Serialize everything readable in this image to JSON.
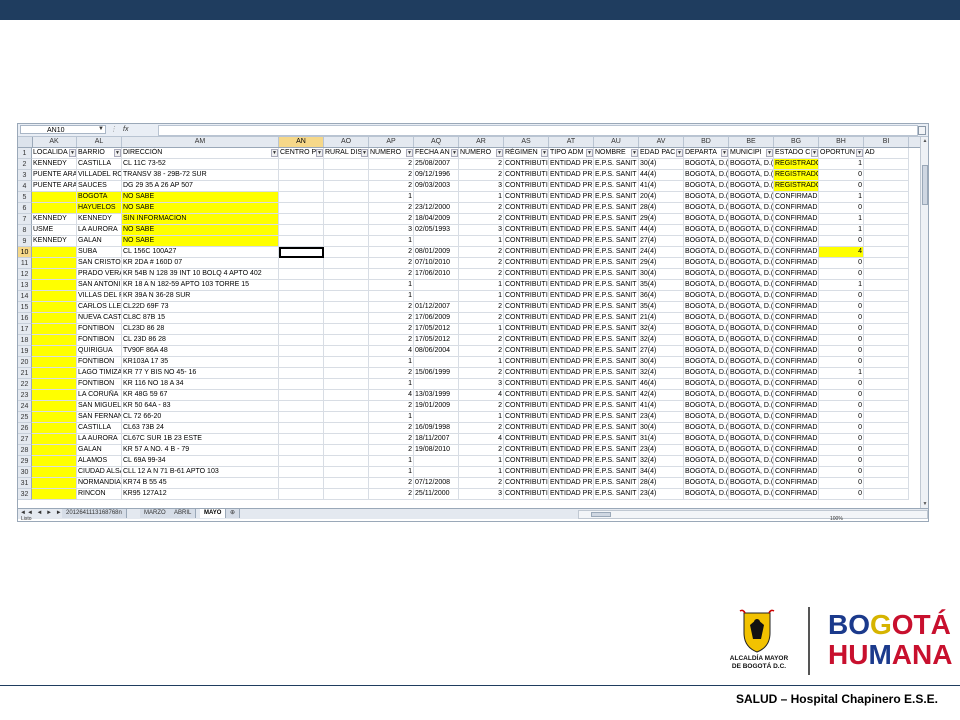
{
  "formula_bar": {
    "name_box": "AN10",
    "fx_label": "fx"
  },
  "columns": [
    {
      "letter": "AK",
      "header": "LOCALIDA",
      "width": 45
    },
    {
      "letter": "AL",
      "header": "BARRIO",
      "width": 45
    },
    {
      "letter": "AM",
      "header": "DIRECCIÓN",
      "width": 157
    },
    {
      "letter": "AN",
      "header": "CENTRO P",
      "width": 45,
      "selected": true
    },
    {
      "letter": "AO",
      "header": "RURAL DIS",
      "width": 45
    },
    {
      "letter": "AP",
      "header": "NÚMERO",
      "width": 45
    },
    {
      "letter": "AQ",
      "header": "FECHA AN",
      "width": 45
    },
    {
      "letter": "AR",
      "header": "NÚMERO",
      "width": 45
    },
    {
      "letter": "AS",
      "header": "RÉGIMEN",
      "width": 45
    },
    {
      "letter": "AT",
      "header": "TIPO ADM",
      "width": 45
    },
    {
      "letter": "AU",
      "header": "NOMBRE",
      "width": 45
    },
    {
      "letter": "AV",
      "header": "EDAD PAC",
      "width": 45
    },
    {
      "letter": "BD",
      "header": "DEPARTA",
      "width": 45
    },
    {
      "letter": "BE",
      "header": "MUNICIPI",
      "width": 45
    },
    {
      "letter": "BG",
      "header": "ESTADO C",
      "width": 45
    },
    {
      "letter": "BH",
      "header": "OPORTUN",
      "width": 45
    },
    {
      "letter": "BI",
      "header": "AD",
      "width": 45
    }
  ],
  "rows": [
    {
      "n": "2",
      "c": [
        "KENNEDY",
        "CASTILLA",
        "CL 11C 73-52",
        "",
        "",
        "2",
        "25/08/2007",
        "2",
        "CONTRIBUTI",
        "ENTIDAD PR",
        "E.P.S. SANIT",
        "30(4)",
        "BOGOTÁ, D.(",
        "BOGOTÁ, D.(",
        "REGISTRADO",
        "1",
        ""
      ],
      "y": [
        14
      ]
    },
    {
      "n": "3",
      "c": [
        "PUENTE ARA",
        "VILLADEL RO",
        "TRANSV 38 - 29B-72 SUR",
        "",
        "",
        "2",
        "09/12/1996",
        "2",
        "CONTRIBUTI",
        "ENTIDAD PR",
        "E.P.S. SANIT",
        "44(4)",
        "BOGOTÁ, D.(",
        "BOGOTÁ, D.(",
        "REGISTRADO",
        "0",
        ""
      ],
      "y": [
        14
      ]
    },
    {
      "n": "4",
      "c": [
        "PUENTE ARA",
        "SAUCES",
        "DG 29 35 A 26 AP 507",
        "",
        "",
        "2",
        "09/03/2003",
        "3",
        "CONTRIBUTI",
        "ENTIDAD PR",
        "E.P.S. SANIT",
        "41(4)",
        "BOGOTÁ, D.(",
        "BOGOTÁ, D.(",
        "REGISTRADO",
        "0",
        ""
      ],
      "y": [
        14
      ]
    },
    {
      "n": "5",
      "c": [
        "",
        "BOGOTA",
        "NO SABE",
        "",
        "",
        "1",
        "",
        "1",
        "CONTRIBUTI",
        "ENTIDAD PR",
        "E.P.S. SANIT",
        "20(4)",
        "BOGOTÁ, D.(",
        "BOGOTÁ, D.(",
        "CONFIRMAD",
        "1",
        ""
      ],
      "y": [
        0,
        1,
        2
      ]
    },
    {
      "n": "6",
      "c": [
        "",
        "HAYUELOS",
        "NO SABE",
        "",
        "",
        "2",
        "23/12/2000",
        "2",
        "CONTRIBUTI",
        "ENTIDAD PR",
        "E.P.S. SANIT",
        "28(4)",
        "BOGOTÁ, D.(",
        "BOGOTÁ, D.(",
        "CONFIRMAD",
        "0",
        ""
      ],
      "y": [
        0,
        1,
        2
      ]
    },
    {
      "n": "7",
      "c": [
        "KENNEDY",
        "KENNEDY",
        "SIN INFORMACION",
        "",
        "",
        "2",
        "18/04/2009",
        "2",
        "CONTRIBUTI",
        "ENTIDAD PR",
        "E.P.S. SANIT",
        "29(4)",
        "BOGOTÁ, D.(",
        "BOGOTÁ, D.(",
        "CONFIRMAD",
        "1",
        ""
      ],
      "y": [
        2
      ]
    },
    {
      "n": "8",
      "c": [
        "USME",
        "LA AURORA",
        "NO SABE",
        "",
        "",
        "3",
        "02/05/1993",
        "3",
        "CONTRIBUTI",
        "ENTIDAD PR",
        "E.P.S. SANIT",
        "44(4)",
        "BOGOTÁ, D.(",
        "BOGOTÁ, D.(",
        "CONFIRMAD",
        "1",
        ""
      ],
      "y": [
        2
      ]
    },
    {
      "n": "9",
      "c": [
        "KENNEDY",
        "GALAN",
        "NO SABE",
        "",
        "",
        "1",
        "",
        "1",
        "CONTRIBUTI",
        "ENTIDAD PR",
        "E.P.S. SANIT",
        "27(4)",
        "BOGOTÁ, D.(",
        "BOGOTÁ, D.(",
        "CONFIRMAD",
        "0",
        ""
      ],
      "y": [
        2
      ]
    },
    {
      "n": "10",
      "c": [
        "",
        "SUBA",
        "CL 156C 100A27",
        "",
        "",
        "2",
        "08/01/2009",
        "2",
        "CONTRIBUTI",
        "ENTIDAD PR",
        "E.P.S. SANIT",
        "24(4)",
        "BOGOTÁ, D.(",
        "BOGOTÁ, D.(",
        "CONFIRMAD",
        "4",
        ""
      ],
      "y": [
        0,
        15
      ],
      "active": true
    },
    {
      "n": "11",
      "c": [
        "",
        "SAN CRISTOB",
        "KR 2DA # 160D 07",
        "",
        "",
        "2",
        "07/10/2010",
        "2",
        "CONTRIBUTI",
        "ENTIDAD PR",
        "E.P.S. SANIT",
        "29(4)",
        "BOGOTÁ, D.(",
        "BOGOTÁ, D.(",
        "CONFIRMAD",
        "0",
        ""
      ],
      "y": [
        0
      ]
    },
    {
      "n": "12",
      "c": [
        "",
        "PRADO VERA",
        "KR 54B N 128 39 INT 10 BOLQ 4 APTO 402",
        "",
        "",
        "2",
        "17/06/2010",
        "2",
        "CONTRIBUTI",
        "ENTIDAD PR",
        "E.P.S. SANIT",
        "30(4)",
        "BOGOTÁ, D.(",
        "BOGOTÁ, D.(",
        "CONFIRMAD",
        "0",
        ""
      ],
      "y": [
        0
      ]
    },
    {
      "n": "13",
      "c": [
        "",
        "SAN ANTONI",
        "KR 18 A N 182-59 APTO 103 TORRE 15",
        "",
        "",
        "1",
        "",
        "1",
        "CONTRIBUTI",
        "ENTIDAD PR",
        "E.P.S. SANIT",
        "35(4)",
        "BOGOTÁ, D.(",
        "BOGOTÁ, D.(",
        "CONFIRMAD",
        "1",
        ""
      ],
      "y": [
        0
      ]
    },
    {
      "n": "14",
      "c": [
        "",
        "VILLAS DEL R",
        "KR 39A N 36-28 SUR",
        "",
        "",
        "1",
        "",
        "1",
        "CONTRIBUTI",
        "ENTIDAD PR",
        "E.P.S. SANIT",
        "36(4)",
        "BOGOTÁ, D.(",
        "BOGOTÁ, D.(",
        "CONFIRMAD",
        "0",
        ""
      ],
      "y": [
        0
      ]
    },
    {
      "n": "15",
      "c": [
        "",
        "CARLOS LLER",
        "CL22D 69F 73",
        "",
        "",
        "2",
        "01/12/2007",
        "2",
        "CONTRIBUTI",
        "ENTIDAD PR",
        "E.P.S. SANIT",
        "35(4)",
        "BOGOTÁ, D.(",
        "BOGOTÁ, D.(",
        "CONFIRMAD",
        "0",
        ""
      ],
      "y": [
        0
      ]
    },
    {
      "n": "16",
      "c": [
        "",
        "NUEVA CAST",
        "CL8C 87B 15",
        "",
        "",
        "2",
        "17/06/2009",
        "2",
        "CONTRIBUTI",
        "ENTIDAD PR",
        "E.P.S. SANIT",
        "21(4)",
        "BOGOTÁ, D.(",
        "BOGOTÁ, D.(",
        "CONFIRMAD",
        "0",
        ""
      ],
      "y": [
        0
      ]
    },
    {
      "n": "17",
      "c": [
        "",
        "FONTIBON",
        "CL23D 86 28",
        "",
        "",
        "2",
        "17/05/2012",
        "1",
        "CONTRIBUTI",
        "ENTIDAD PR",
        "E.P.S. SANIT",
        "32(4)",
        "BOGOTÁ, D.(",
        "BOGOTÁ, D.(",
        "CONFIRMAD",
        "0",
        ""
      ],
      "y": [
        0
      ]
    },
    {
      "n": "18",
      "c": [
        "",
        "FONTIBON",
        "CL 23D 86 28",
        "",
        "",
        "2",
        "17/05/2012",
        "2",
        "CONTRIBUTI",
        "ENTIDAD PR",
        "E.P.S. SANIT",
        "32(4)",
        "BOGOTÁ, D.(",
        "BOGOTÁ, D.(",
        "CONFIRMAD",
        "0",
        ""
      ],
      "y": [
        0
      ]
    },
    {
      "n": "19",
      "c": [
        "",
        "QUIRIGUA",
        "TV90F 86A 48",
        "",
        "",
        "4",
        "08/06/2004",
        "2",
        "CONTRIBUTI",
        "ENTIDAD PR",
        "E.P.S. SANIT",
        "27(4)",
        "BOGOTÁ, D.(",
        "BOGOTÁ, D.(",
        "CONFIRMAD",
        "0",
        ""
      ],
      "y": [
        0
      ]
    },
    {
      "n": "20",
      "c": [
        "",
        "FONTIBON",
        "KR103A 17 35",
        "",
        "",
        "1",
        "",
        "1",
        "CONTRIBUTI",
        "ENTIDAD PR",
        "E.P.S. SANIT",
        "30(4)",
        "BOGOTÁ, D.(",
        "BOGOTÁ, D.(",
        "CONFIRMAD",
        "0",
        ""
      ],
      "y": [
        0
      ]
    },
    {
      "n": "21",
      "c": [
        "",
        "LAGO TIMIZA",
        "KR 77 Y BIS NO 45- 16",
        "",
        "",
        "2",
        "15/06/1999",
        "2",
        "CONTRIBUTI",
        "ENTIDAD PR",
        "E.P.S. SANIT",
        "32(4)",
        "BOGOTÁ, D.(",
        "BOGOTÁ, D.(",
        "CONFIRMAD",
        "1",
        ""
      ],
      "y": [
        0
      ]
    },
    {
      "n": "22",
      "c": [
        "",
        "FONTIBON",
        "KR 116 NO 18 A 34",
        "",
        "",
        "1",
        "",
        "3",
        "CONTRIBUTI",
        "ENTIDAD PR",
        "E.P.S. SANIT",
        "46(4)",
        "BOGOTÁ, D.(",
        "BOGOTÁ, D.(",
        "CONFIRMAD",
        "0",
        ""
      ],
      "y": [
        0
      ]
    },
    {
      "n": "23",
      "c": [
        "",
        "LA CORUÑA",
        "KR 48G 59 67",
        "",
        "",
        "4",
        "13/03/1999",
        "4",
        "CONTRIBUTI",
        "ENTIDAD PR",
        "E.P.S. SANIT",
        "42(4)",
        "BOGOTÁ, D.(",
        "BOGOTÁ, D.(",
        "CONFIRMAD",
        "0",
        ""
      ],
      "y": [
        0
      ]
    },
    {
      "n": "24",
      "c": [
        "",
        "SAN MIGUEL",
        "KR 50 64A - 83",
        "",
        "",
        "2",
        "19/01/2009",
        "2",
        "CONTRIBUTI",
        "ENTIDAD PR",
        "E.P.S. SANIT",
        "41(4)",
        "BOGOTÁ, D.(",
        "BOGOTÁ, D.(",
        "CONFIRMAD",
        "0",
        ""
      ],
      "y": [
        0
      ]
    },
    {
      "n": "25",
      "c": [
        "",
        "SAN FERNAN",
        "CL 72 66-20",
        "",
        "",
        "1",
        "",
        "1",
        "CONTRIBUTI",
        "ENTIDAD PR",
        "E.P.S. SANIT",
        "23(4)",
        "BOGOTÁ, D.(",
        "BOGOTÁ, D.(",
        "CONFIRMAD",
        "0",
        ""
      ],
      "y": [
        0
      ]
    },
    {
      "n": "26",
      "c": [
        "",
        "CASTILLA",
        "CL63 73B 24",
        "",
        "",
        "2",
        "16/09/1998",
        "2",
        "CONTRIBUTI",
        "ENTIDAD PR",
        "E.P.S. SANIT",
        "30(4)",
        "BOGOTÁ, D.(",
        "BOGOTÁ, D.(",
        "CONFIRMAD",
        "0",
        ""
      ],
      "y": [
        0
      ]
    },
    {
      "n": "27",
      "c": [
        "",
        "LA AURORA",
        "CL67C SUR 1B 23 ESTE",
        "",
        "",
        "2",
        "18/11/2007",
        "4",
        "CONTRIBUTI",
        "ENTIDAD PR",
        "E.P.S. SANIT",
        "31(4)",
        "BOGOTÁ, D.(",
        "BOGOTÁ, D.(",
        "CONFIRMAD",
        "0",
        ""
      ],
      "y": [
        0
      ]
    },
    {
      "n": "28",
      "c": [
        "",
        "GALAN",
        "KR 57 A NO. 4 B - 79",
        "",
        "",
        "2",
        "19/08/2010",
        "2",
        "CONTRIBUTI",
        "ENTIDAD PR",
        "E.P.S. SANIT",
        "23(4)",
        "BOGOTÁ, D.(",
        "BOGOTÁ, D.(",
        "CONFIRMAD",
        "0",
        ""
      ],
      "y": [
        0
      ]
    },
    {
      "n": "29",
      "c": [
        "",
        "ALAMOS",
        "CL 69A 99-34",
        "",
        "",
        "1",
        "",
        "1",
        "CONTRIBUTI",
        "ENTIDAD PR",
        "E.P.S. SANIT",
        "32(4)",
        "BOGOTÁ, D.(",
        "BOGOTÁ, D.(",
        "CONFIRMAD",
        "0",
        ""
      ],
      "y": [
        0
      ]
    },
    {
      "n": "30",
      "c": [
        "",
        "CIUDAD ALSA",
        "CLL 12 A N 71 B-61 APTO 103",
        "",
        "",
        "1",
        "",
        "1",
        "CONTRIBUTI",
        "ENTIDAD PR",
        "E.P.S. SANIT",
        "34(4)",
        "BOGOTÁ, D.(",
        "BOGOTÁ, D.(",
        "CONFIRMAD",
        "0",
        ""
      ],
      "y": [
        0
      ]
    },
    {
      "n": "31",
      "c": [
        "",
        "NORMANDIA",
        "KR74 B 55 45",
        "",
        "",
        "2",
        "07/12/2008",
        "2",
        "CONTRIBUTI",
        "ENTIDAD PR",
        "E.P.S. SANIT",
        "28(4)",
        "BOGOTÁ, D.(",
        "BOGOTÁ, D.(",
        "CONFIRMAD",
        "0",
        ""
      ],
      "y": [
        0
      ]
    },
    {
      "n": "32",
      "c": [
        "",
        "RINCON",
        "KR95 127A12",
        "",
        "",
        "2",
        "25/11/2000",
        "3",
        "CONTRIBUTI",
        "ENTIDAD PR",
        "E.P.S. SANIT",
        "23(4)",
        "BOGOTÁ, D.(",
        "BOGOTÁ, D.(",
        "CONFIRMAD",
        "0",
        ""
      ],
      "y": [
        0
      ]
    }
  ],
  "sheet_tabs": [
    "2012641113168768n",
    "MARZO",
    "ABRIL",
    "MAYO"
  ],
  "active_tab": "MAYO",
  "status": {
    "left": "Listo",
    "zoom": "100%"
  },
  "logos": {
    "alcaldia_line1": "ALCALDÍA MAYOR",
    "alcaldia_line2": "DE BOGOTÁ D.C.",
    "bogota": "BOGOTÁ",
    "humana": "HUMANA"
  },
  "footer": "SALUD – Hospital Chapinero E.S.E.",
  "colors": {
    "topbar": "#1f3d5f",
    "highlight": "#ffff00",
    "selected_header": "#f6d889"
  }
}
